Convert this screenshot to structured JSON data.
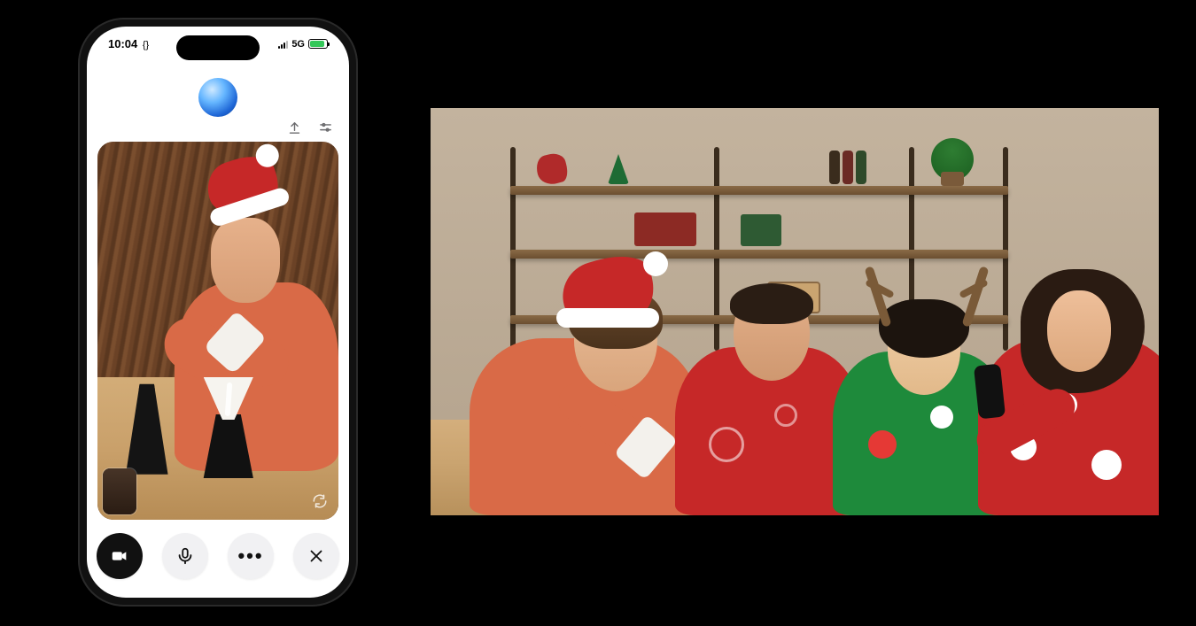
{
  "phone": {
    "status": {
      "time": "10:04",
      "time_suffix": "{}",
      "network": "5G"
    },
    "controls": {
      "camera": "camera",
      "mic": "microphone",
      "more": "more",
      "close": "close"
    }
  },
  "scene": {
    "phone_feed": {
      "description": "Person in Santa hat and orange sweater pouring from a white cup into a pour-over coffee dripper on a black carafe, black kettle nearby, wooden table, dark wood-paneled background.",
      "objects": [
        "santa-hat",
        "orange-sweater",
        "white-cup",
        "pour-over-dripper",
        "black-carafe",
        "black-kettle",
        "wood-table"
      ]
    },
    "wide_feed": {
      "description": "Four people at a wooden table in front of wooden wall shelves with holiday decorations. Left person in Santa hat and orange sweater pouring coffee; second in red holiday sweater; third with reindeer antlers and green holiday sweater; fourth in red Santa-print sweater holding a phone.",
      "people": [
        {
          "hat": "santa-hat",
          "top_color": "#d96a47"
        },
        {
          "hat": "none",
          "top_color": "#c62828"
        },
        {
          "hat": "reindeer-antlers",
          "top_color": "#1e8a3b"
        },
        {
          "hat": "none",
          "top_color": "#c62828"
        }
      ]
    }
  },
  "colors": {
    "accent_red": "#c62828",
    "accent_green": "#1e8a3b",
    "sweater_orange": "#d96a47",
    "wood": "#c9a06a"
  }
}
